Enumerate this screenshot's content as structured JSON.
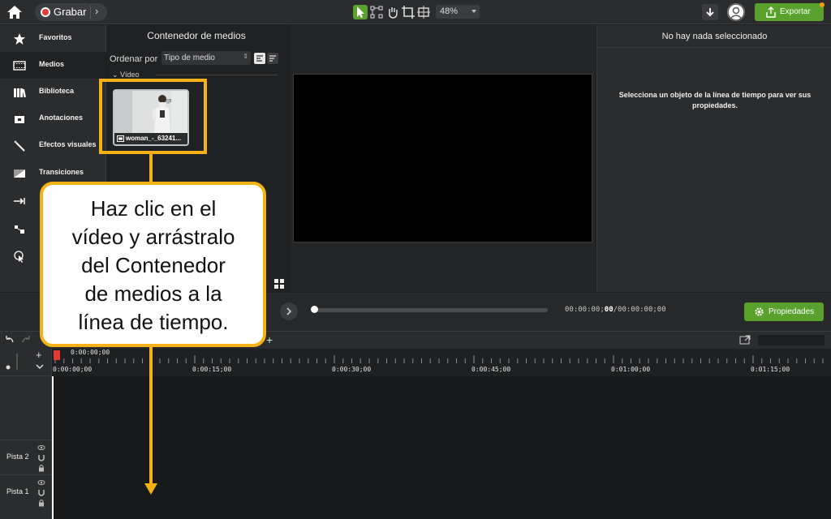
{
  "topbar": {
    "record_label": "Grabar",
    "zoom_value": "48%",
    "export_label": "Exportar"
  },
  "sidebar": {
    "items": [
      {
        "label": "Favoritos",
        "icon": "star-icon"
      },
      {
        "label": "Medios",
        "icon": "film-icon"
      },
      {
        "label": "Biblioteca",
        "icon": "library-icon"
      },
      {
        "label": "Anotaciones",
        "icon": "annotation-icon"
      },
      {
        "label": "Efectos visuales",
        "icon": "magic-wand-icon"
      },
      {
        "label": "Transiciones",
        "icon": "transition-icon"
      }
    ]
  },
  "media_bin": {
    "title": "Contenedor de medios",
    "sort_by_label": "Ordenar por",
    "sort_value": "Tipo de medio",
    "section_label": "Vídeo",
    "clip_name": "woman_-_63241..."
  },
  "properties": {
    "title": "No hay nada seleccionado",
    "message": "Selecciona un objeto de la línea de tiempo para ver sus propiedades."
  },
  "transport": {
    "timecode_current": "00:00:00;",
    "timecode_bold": "00",
    "timecode_total": "/00:00:00;00",
    "progress": 0.0,
    "properties_button": "Propiedades"
  },
  "timeline": {
    "playhead_time": "0:00:00;00",
    "ruler_labels": [
      "0:00:00;00",
      "0:00:15;00",
      "0:00:30;00",
      "0:00:45;00",
      "0:01:00;00",
      "0:01:15;00"
    ],
    "tracks": [
      "Pista 2",
      "Pista 1"
    ]
  },
  "callout": {
    "lines": [
      "Haz clic en el",
      "vídeo y arrástralo",
      "del Contenedor",
      "de medios a la",
      "línea de tiempo."
    ]
  },
  "colors": {
    "accent_green": "#5aa02c",
    "callout_yellow": "#f5b217",
    "record_red": "#e33a36"
  }
}
